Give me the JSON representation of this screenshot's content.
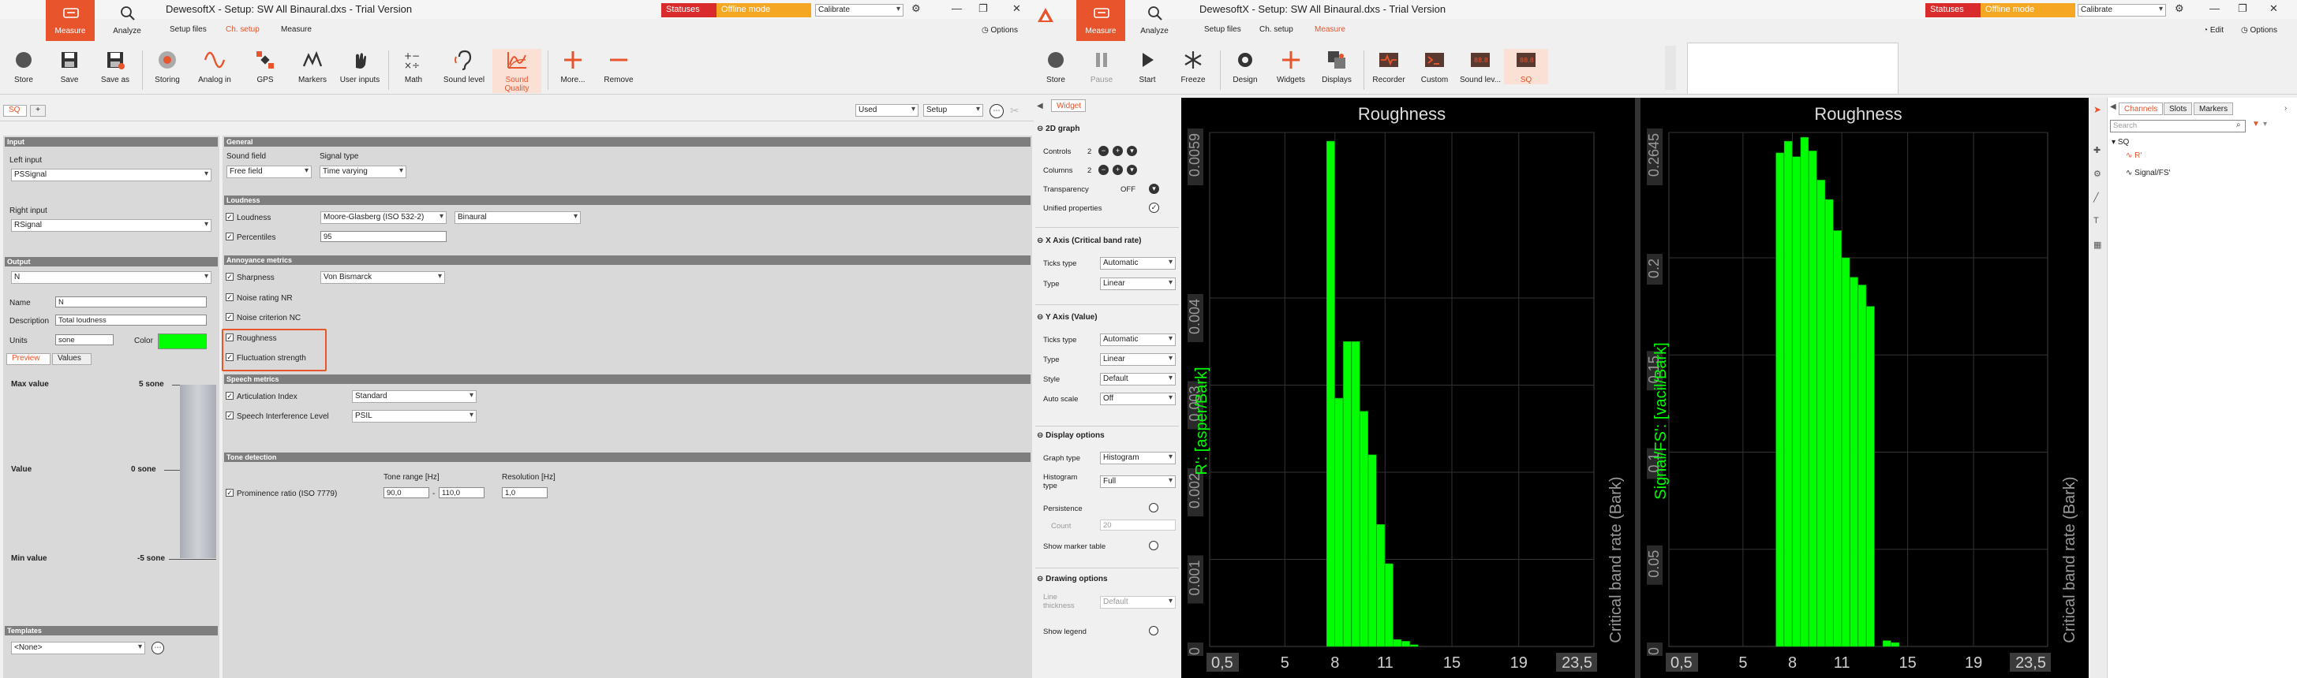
{
  "left": {
    "app_title": "DewesoftX - Setup: SW All Binaural.dxs - Trial Version",
    "modes": {
      "measure": "Measure",
      "analyze": "Analyze"
    },
    "subtabs": [
      "Setup files",
      "Ch. setup",
      "Measure"
    ],
    "statuses": "Statuses",
    "offline": "Offline mode",
    "calibrate": "Calibrate",
    "options": "Options",
    "toolbar": [
      {
        "id": "store",
        "label": "Store",
        "icon": "record-icon"
      },
      {
        "id": "save",
        "label": "Save",
        "icon": "floppy-icon"
      },
      {
        "id": "saveas",
        "label": "Save as",
        "icon": "floppy-as-icon"
      },
      {
        "id": "storing",
        "label": "Storing",
        "icon": "storing-icon"
      },
      {
        "id": "analog",
        "label": "Analog in",
        "icon": "sine-wave-icon"
      },
      {
        "id": "gps",
        "label": "GPS",
        "icon": "satellite-icon"
      },
      {
        "id": "markers",
        "label": "Markers",
        "icon": "markers-icon"
      },
      {
        "id": "userinputs",
        "label": "User inputs",
        "icon": "hand-icon"
      },
      {
        "id": "math",
        "label": "Math",
        "icon": "math-icon"
      },
      {
        "id": "soundlevel",
        "label": "Sound level",
        "icon": "ear-icon"
      },
      {
        "id": "soundquality",
        "label": "Sound Quality",
        "icon": "sound-quality-icon"
      },
      {
        "id": "more",
        "label": "More...",
        "icon": "plus-icon"
      },
      {
        "id": "remove",
        "label": "Remove",
        "icon": "minus-icon"
      }
    ],
    "sq_tab": "SQ",
    "add_tab": "+",
    "used": "Used",
    "setup": "Setup",
    "input": {
      "header": "Input",
      "left_label": "Left input",
      "left_value": "PSSignal",
      "right_label": "Right input",
      "right_value": "RSignal"
    },
    "output": {
      "header": "Output",
      "selected": "N",
      "name_label": "Name",
      "name_value": "N",
      "desc_label": "Description",
      "desc_value": "Total loudness",
      "units_label": "Units",
      "units_value": "sone",
      "color_label": "Color",
      "color": "#00ff00",
      "preview_tab": "Preview",
      "values_tab": "Values",
      "max_label": "Max value",
      "max_value": "5 sone",
      "value_label": "Value",
      "value_value": "0 sone",
      "min_label": "Min value",
      "min_value": "-5 sone"
    },
    "templates": {
      "header": "Templates",
      "value": "<None>"
    },
    "general": {
      "header": "General",
      "sound_field_label": "Sound field",
      "sound_field_value": "Free field",
      "signal_type_label": "Signal type",
      "signal_type_value": "Time varying"
    },
    "loudness": {
      "header": "Loudness",
      "loudness_label": "Loudness",
      "method": "Moore-Glasberg (ISO 532-2)",
      "mode": "Binaural",
      "percentiles_label": "Percentiles",
      "percentiles_value": "95"
    },
    "annoyance": {
      "header": "Annoyance metrics",
      "sharpness_label": "Sharpness",
      "sharpness_method": "Von Bismarck",
      "nr_label": "Noise rating NR",
      "nc_label": "Noise criterion NC",
      "roughness_label": "Roughness",
      "fluctuation_label": "Fluctuation strength"
    },
    "speech": {
      "header": "Speech metrics",
      "ai_label": "Articulation Index",
      "ai_value": "Standard",
      "sil_label": "Speech Interference Level",
      "sil_value": "PSIL"
    },
    "tone": {
      "header": "Tone detection",
      "range_label": "Tone range [Hz]",
      "resolution_label": "Resolution [Hz]",
      "prominence_label": "Prominence ratio (ISO 7779)",
      "range_from": "90,0",
      "range_sep": "-",
      "range_to": "110,0",
      "resolution_value": "1,0"
    }
  },
  "right": {
    "app_title": "DewesoftX - Setup: SW All Binaural.dxs - Trial Version",
    "modes": {
      "measure": "Measure",
      "analyze": "Analyze"
    },
    "subtabs": [
      "Setup files",
      "Ch. setup",
      "Measure"
    ],
    "statuses": "Statuses",
    "offline": "Offline mode",
    "calibrate": "Calibrate",
    "edit": "Edit",
    "options": "Options",
    "toolbar": [
      {
        "id": "store",
        "label": "Store",
        "icon": "record-icon"
      },
      {
        "id": "pause",
        "label": "Pause",
        "icon": "pause-icon"
      },
      {
        "id": "start",
        "label": "Start",
        "icon": "play-icon"
      },
      {
        "id": "freeze",
        "label": "Freeze",
        "icon": "snowflake-icon"
      },
      {
        "id": "design",
        "label": "Design",
        "icon": "gear-icon"
      },
      {
        "id": "widgets",
        "label": "Widgets",
        "icon": "plus-icon"
      },
      {
        "id": "displays",
        "label": "Displays",
        "icon": "displays-icon"
      },
      {
        "id": "recorder",
        "label": "Recorder",
        "icon": "recorder-icon"
      },
      {
        "id": "custom",
        "label": "Custom",
        "icon": "terminal-icon"
      },
      {
        "id": "soundlev",
        "label": "Sound lev...",
        "icon": "sound-level-display-icon"
      },
      {
        "id": "sq",
        "label": "SQ",
        "icon": "sq-display-icon"
      }
    ],
    "widget_tab": "Widget",
    "graph2d": {
      "header": "2D graph",
      "controls_label": "Controls",
      "controls_value": "2",
      "columns_label": "Columns",
      "columns_value": "2",
      "transparency_label": "Transparency",
      "transparency_value": "OFF",
      "unified_label": "Unified properties"
    },
    "xaxis": {
      "header": "X Axis (Critical band rate)",
      "ticks_label": "Ticks type",
      "ticks_value": "Automatic",
      "type_label": "Type",
      "type_value": "Linear"
    },
    "yaxis": {
      "header": "Y Axis (Value)",
      "ticks_label": "Ticks type",
      "ticks_value": "Automatic",
      "type_label": "Type",
      "type_value": "Linear",
      "style_label": "Style",
      "style_value": "Default",
      "autoscale_label": "Auto scale",
      "autoscale_value": "Off"
    },
    "display": {
      "header": "Display options",
      "graph_type_label": "Graph type",
      "graph_type_value": "Histogram",
      "hist_type_label": "Histogram type",
      "hist_type_value": "Full",
      "persistence_label": "Persistence",
      "count_label": "Count",
      "count_value": "20",
      "marker_table_label": "Show marker table"
    },
    "drawing": {
      "header": "Drawing options",
      "line_thickness_label": "Line thickness",
      "line_thickness_value": "Default",
      "legend_label": "Show legend"
    },
    "channels": {
      "tabs": [
        "Channels",
        "Slots",
        "Markers"
      ],
      "search_placeholder": "Search",
      "tree_root": "SQ",
      "tree_items": [
        "R'",
        "Signal/FS'"
      ]
    }
  },
  "chart_data": [
    {
      "type": "bar",
      "title": "Roughness",
      "ylabel": "R': [asper/Bark]",
      "xlabel": "Critical band rate (Bark)",
      "xlim": [
        0.5,
        23.5
      ],
      "x_ticks": [
        "0,5",
        "5",
        "8",
        "11",
        "15",
        "19",
        "23,5"
      ],
      "ylim": [
        0,
        0.0059
      ],
      "y_ticks": [
        "0",
        "0.001",
        "0.002",
        "0.003",
        "0.004",
        "0.0059"
      ],
      "grid": true,
      "color": "#00ff00",
      "bins_start": 7.5,
      "bin_width": 0.5,
      "values": [
        0.0058,
        0.00285,
        0.0035,
        0.0035,
        0.0027,
        0.0022,
        0.0014,
        0.00095,
        8e-05,
        6e-05,
        2e-05
      ]
    },
    {
      "type": "bar",
      "title": "Roughness",
      "ylabel": "Signal/FS': [vacil/Bark]",
      "xlabel": "Critical band rate (Bark)",
      "xlim": [
        0.5,
        23.5
      ],
      "x_ticks": [
        "0,5",
        "5",
        "8",
        "11",
        "15",
        "19",
        "23,5"
      ],
      "ylim": [
        0,
        0.2645
      ],
      "y_ticks": [
        "0",
        "0.05",
        "0.1",
        "0.15",
        "0.2",
        "0.2645"
      ],
      "grid": true,
      "color": "#00ff00",
      "bins_start": 7.0,
      "bin_width": 0.5,
      "values": [
        0.254,
        0.26,
        0.252,
        0.262,
        0.255,
        0.24,
        0.23,
        0.214,
        0.2,
        0.19,
        0.186,
        0.175,
        0.0,
        0.003,
        0.002
      ]
    }
  ]
}
